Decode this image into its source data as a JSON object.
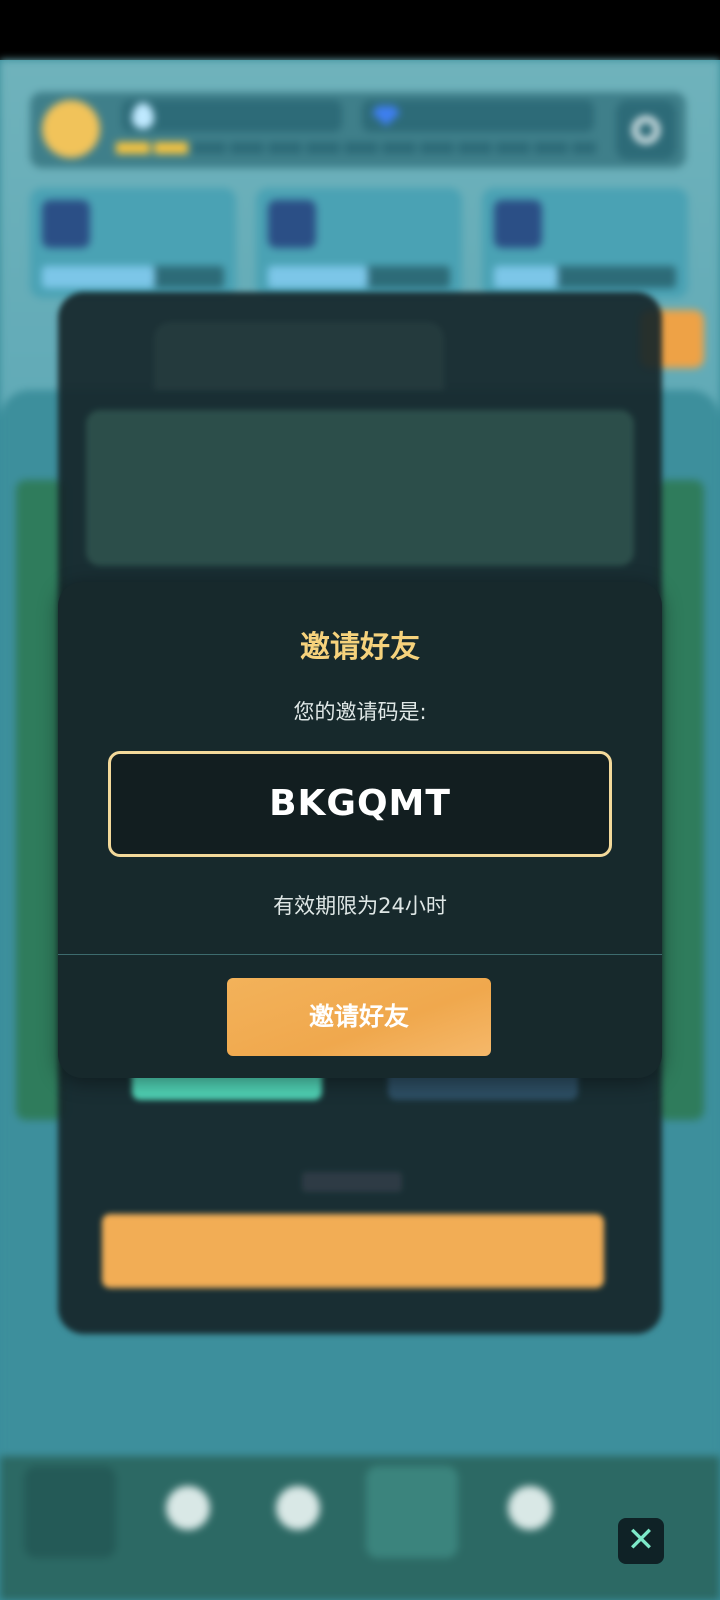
{
  "modal": {
    "title": "邀请好友",
    "code_label": "您的邀请码是:",
    "code": "BKGQMT",
    "expiry": "有效期限为24小时",
    "button": "邀请好友"
  },
  "close_button": {
    "icon": "close-icon",
    "glyph": "✕"
  },
  "colors": {
    "modal_bg": "#17292c",
    "title": "#f6d27c",
    "code_border": "#f3d99a",
    "button": "#f0a84d",
    "close_icon": "#7de9c9"
  }
}
